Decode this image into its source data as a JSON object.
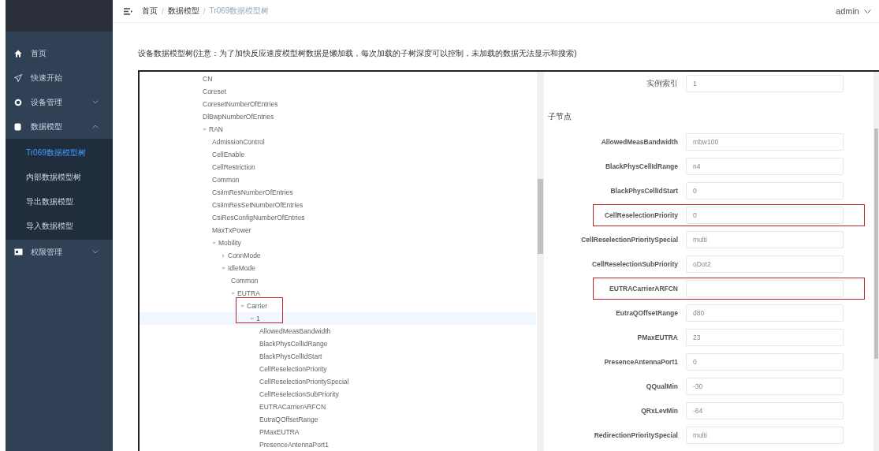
{
  "sidebar": {
    "items": [
      {
        "label": "首页"
      },
      {
        "label": "快速开始"
      },
      {
        "label": "设备管理",
        "expanded": false
      },
      {
        "label": "数据模型",
        "expanded": true,
        "children": [
          {
            "label": "Tr069数据模型树",
            "selected": true
          },
          {
            "label": "内部数据模型树",
            "selected": false
          },
          {
            "label": "导出数据模型",
            "selected": false
          },
          {
            "label": "导入数据模型",
            "selected": false
          }
        ]
      },
      {
        "label": "权限管理",
        "expanded": false
      }
    ]
  },
  "header": {
    "breadcrumb": [
      "首页",
      "数据模型",
      "Tr069数据模型树"
    ],
    "breadcrumb_separators": [
      "/",
      "/"
    ],
    "user": "admin"
  },
  "description": "设备数据模型树(注意：为了加快反应速度模型树数据是懒加载，每次加载的子树深度可以控制，未加载的数据无法显示和搜索)",
  "tree": [
    {
      "label": "CN",
      "selected": false
    },
    {
      "label": "Coreset",
      "selected": false
    },
    {
      "label": "CoresetNumberOfEntries",
      "selected": false
    },
    {
      "label": "DlBwpNumberOfEntries",
      "selected": false
    },
    {
      "label": "RAN",
      "selected": false,
      "expanded": true,
      "children": [
        {
          "label": "AdmissionControl",
          "selected": false
        },
        {
          "label": "CellEnable",
          "selected": false
        },
        {
          "label": "CellRestriction",
          "selected": false
        },
        {
          "label": "Common",
          "selected": false
        },
        {
          "label": "CsiImResNumberOfEntries",
          "selected": false
        },
        {
          "label": "CsiImResSetNumberOfEntries",
          "selected": false
        },
        {
          "label": "CsiResConfigNumberOfEntries",
          "selected": false
        },
        {
          "label": "MaxTxPower",
          "selected": false
        },
        {
          "label": "Mobility",
          "selected": false,
          "expanded": true,
          "children": [
            {
              "label": "ConnMode",
              "selected": false,
              "expanded": false
            },
            {
              "label": "IdleMode",
              "selected": false,
              "expanded": true,
              "children": [
                {
                  "label": "Common",
                  "selected": false
                },
                {
                  "label": "EUTRA",
                  "selected": false,
                  "expanded": true,
                  "children": [
                    {
                      "label": "Carrier",
                      "selected": false,
                      "expanded": true,
                      "highlighted": true,
                      "children": [
                        {
                          "label": "1",
                          "selected": true,
                          "expanded": true,
                          "children": [
                            {
                              "label": "AllowedMeasBandwidth",
                              "selected": false
                            },
                            {
                              "label": "BlackPhysCellIdRange",
                              "selected": false
                            },
                            {
                              "label": "BlackPhysCellIdStart",
                              "selected": false
                            },
                            {
                              "label": "CellReselectionPriority",
                              "selected": false
                            },
                            {
                              "label": "CellReselectionPrioritySpecial",
                              "selected": false
                            },
                            {
                              "label": "CellReselectionSubPriority",
                              "selected": false
                            },
                            {
                              "label": "EUTRACarrierARFCN",
                              "selected": false
                            },
                            {
                              "label": "EutraQOffsetRange",
                              "selected": false
                            },
                            {
                              "label": "PMaxEUTRA",
                              "selected": false
                            },
                            {
                              "label": "PresenceAntennaPort1",
                              "selected": false
                            }
                          ]
                        }
                      ]
                    }
                  ]
                }
              ]
            }
          ]
        }
      ]
    }
  ],
  "detail": {
    "instance_index": {
      "label": "实例索引",
      "value": "1"
    },
    "section_title": "子节点",
    "fields": [
      {
        "label": "AllowedMeasBandwidth",
        "value": "mbw100",
        "highlighted": false
      },
      {
        "label": "BlackPhysCellIdRange",
        "value": "n4",
        "highlighted": false
      },
      {
        "label": "BlackPhysCellIdStart",
        "value": "0",
        "highlighted": false
      },
      {
        "label": "CellReselectionPriority",
        "value": "0",
        "highlighted": true
      },
      {
        "label": "CellReselectionPrioritySpecial",
        "value": "multi",
        "highlighted": false
      },
      {
        "label": "CellReselectionSubPriority",
        "value": "oDot2",
        "highlighted": false
      },
      {
        "label": "EUTRACarrierARFCN",
        "highlighted": true
      },
      {
        "label": "EutraQOffsetRange",
        "value": "d80",
        "highlighted": false
      },
      {
        "label": "PMaxEUTRA",
        "value": "23",
        "highlighted": false
      },
      {
        "label": "PresenceAntennaPort1",
        "value": "0",
        "highlighted": false
      },
      {
        "label": "QQualMin",
        "value": "-30",
        "highlighted": false
      },
      {
        "label": "QRxLevMin",
        "value": "-64",
        "highlighted": false
      },
      {
        "label": "RedirectionPrioritySpecial",
        "value": "multi",
        "highlighted": false
      }
    ]
  }
}
